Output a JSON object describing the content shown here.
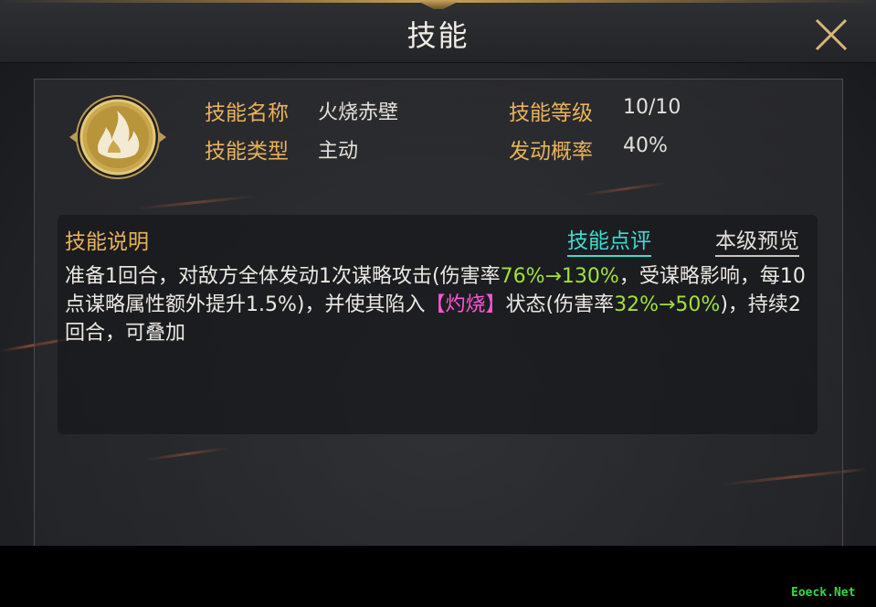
{
  "header": {
    "title": "技能"
  },
  "skill_info": {
    "name_label": "技能名称",
    "name_value": "火烧赤壁",
    "level_label": "技能等级",
    "level_value": "10/10",
    "type_label": "技能类型",
    "type_value": "主动",
    "chance_label": "发动概率",
    "chance_value": "40%"
  },
  "description": {
    "title": "技能说明",
    "tab_review": "技能点评",
    "tab_preview": "本级预览",
    "seg1": "准备1回合，对敌方全体发动1次谋略攻击(伤害率",
    "seg2": "76%→130%",
    "seg3": "，受谋略影响，每10点谋略属性额外提升1.5%)，并使其陷入",
    "seg4": "【灼烧】",
    "seg5": "状态(伤害率",
    "seg6": "32%→50%",
    "seg7": ")，持续2回合，可叠加"
  },
  "watermark": "Eoeck.Net",
  "colors": {
    "gold_label": "#e8b25a",
    "highlight_green": "#9ee23b",
    "status_pink": "#ff56d6",
    "tab_cyan": "#3fdcd0"
  },
  "icons": {
    "close": "close-icon",
    "emblem": "fire-skill-icon"
  }
}
